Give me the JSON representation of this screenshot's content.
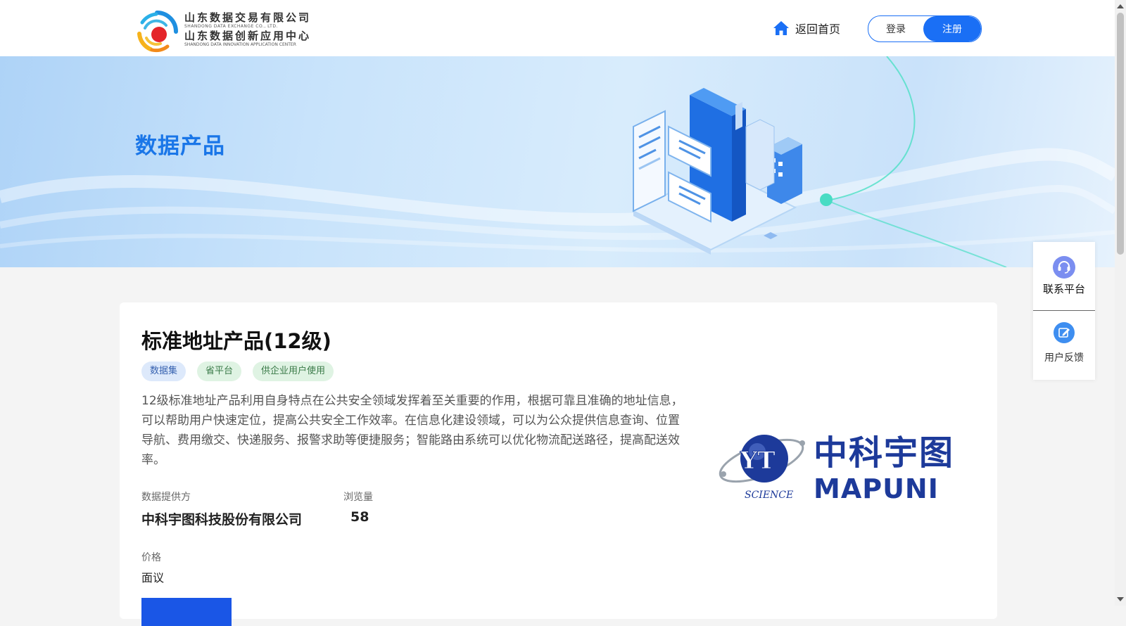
{
  "header": {
    "logo": {
      "line1": "山东数据交易有限公司",
      "line2": "SHANDONG DATA EXCHANGE CO., LTD.",
      "line3": "山东数据创新应用中心",
      "line4": "SHANDONG DATA INNOVATION APPLICATION CENTER"
    },
    "home_label": "返回首页",
    "login_label": "登录",
    "register_label": "注册"
  },
  "banner": {
    "title": "数据产品"
  },
  "product": {
    "title": "标准地址产品(12级)",
    "tags": [
      "数据集",
      "省平台",
      "供企业用户使用"
    ],
    "description": "12级标准地址产品利用自身特点在公共安全领域发挥着至关重要的作用，根据可靠且准确的地址信息，可以帮助用户快速定位，提高公共安全工作效率。在信息化建设领域，可以为公众提供信息查询、位置导航、费用缴交、快递服务、报警求助等便捷服务；智能路由系统可以优化物流配送路径，提高配送效率。",
    "provider_label": "数据提供方",
    "provider_value": "中科宇图科技股份有限公司",
    "views_label": "浏览量",
    "views_value": "58",
    "price_label": "价格",
    "price_value": "面议"
  },
  "vendor_logo": {
    "cn_name": "中科宇图",
    "en_name": "MAPUNI",
    "emblem_text": "SCIENCE",
    "emblem_letters": "YT"
  },
  "float_panel": {
    "contact_label": "联系平台",
    "feedback_label": "用户反馈"
  },
  "colors": {
    "accent": "#1a6ff5",
    "banner_title": "#1a76e8",
    "vendor_navy": "#1e3a8a"
  }
}
